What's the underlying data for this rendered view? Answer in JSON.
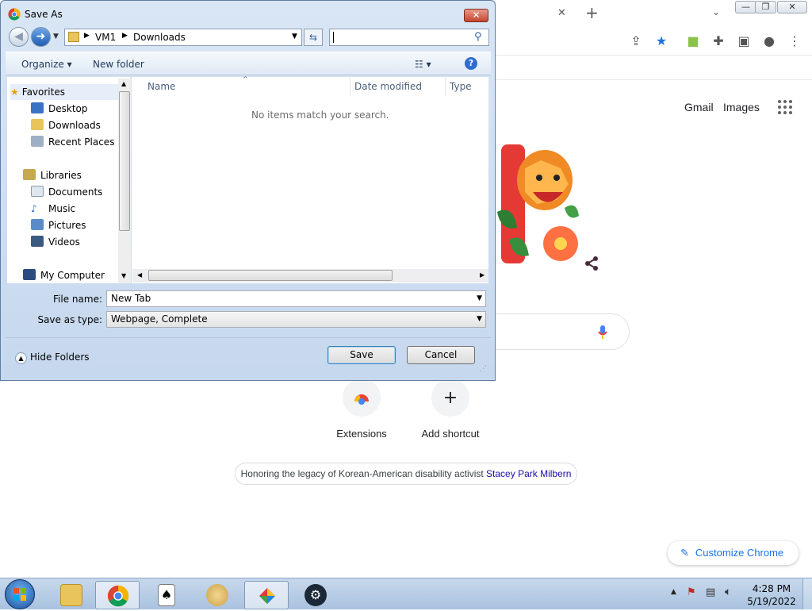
{
  "browser": {
    "tab_close": "✕",
    "new_tab": "+",
    "header_links": {
      "gmail": "Gmail",
      "images": "Images"
    },
    "shortcuts": [
      {
        "label": "Extensions"
      },
      {
        "label": "Add shortcut",
        "icon": "+"
      }
    ],
    "honor_text": "Honoring the legacy of Korean-American disability activist ",
    "honor_link": "Stacey Park Milbern",
    "customize_label": "Customize Chrome"
  },
  "dialog": {
    "title": "Save As",
    "address_path": [
      "VM1",
      "Downloads"
    ],
    "search_value": "",
    "toolbar": {
      "organize": "Organize",
      "new_folder": "New folder"
    },
    "nav": {
      "favorites_header": "Favorites",
      "favorites": [
        "Desktop",
        "Downloads",
        "Recent Places"
      ],
      "libraries_header": "Libraries",
      "libraries": [
        "Documents",
        "Music",
        "Pictures",
        "Videos"
      ],
      "computer": "My Computer"
    },
    "columns": [
      "Name",
      "Date modified",
      "Type"
    ],
    "empty_message": "No items match your search.",
    "file_name_label": "File name:",
    "file_name_value": "New Tab",
    "save_type_label": "Save as type:",
    "save_type_value": "Webpage, Complete",
    "save_button": "Save",
    "cancel_button": "Cancel",
    "hide_folders": "Hide Folders"
  },
  "taskbar": {
    "time": "4:28 PM",
    "date": "5/19/2022"
  },
  "colors": {
    "accent": "#1a73e8",
    "dialog_bg": "#d9e6f5",
    "taskbar": "#b7cce5"
  }
}
